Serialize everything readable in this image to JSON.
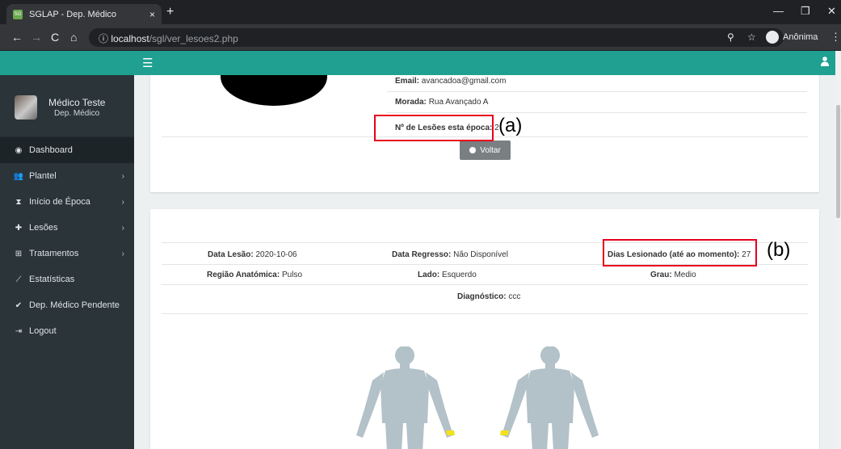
{
  "browser": {
    "tab_title": "SGLAP - Dep. Médico",
    "tab_close": "×",
    "new_tab": "+",
    "url_host": "localhost",
    "url_path": "/sgl/ver_lesoes2.php",
    "incognito_label": "Anônima",
    "minimize": "—",
    "restore": "❐",
    "close": "✕"
  },
  "sidebar": {
    "user_name": "Médico Teste",
    "user_dept": "Dep. Médico",
    "items": [
      {
        "label": "Dashboard",
        "icon": "dashboard-icon",
        "glyph": "◉",
        "chevron": ""
      },
      {
        "label": "Plantel",
        "icon": "users-icon",
        "glyph": "👥",
        "chevron": "›"
      },
      {
        "label": "Início de Época",
        "icon": "hourglass-icon",
        "glyph": "⧗",
        "chevron": "›"
      },
      {
        "label": "Lesões",
        "icon": "ambulance-icon",
        "glyph": "✚",
        "chevron": "›"
      },
      {
        "label": "Tratamentos",
        "icon": "plus-square-icon",
        "glyph": "⊞",
        "chevron": "›"
      },
      {
        "label": "Estatísticas",
        "icon": "chart-icon",
        "glyph": "⟋",
        "chevron": ""
      },
      {
        "label": "Dep. Médico Pendente",
        "icon": "check-icon",
        "glyph": "✔",
        "chevron": ""
      },
      {
        "label": "Logout",
        "icon": "logout-icon",
        "glyph": "⇥",
        "chevron": ""
      }
    ]
  },
  "player": {
    "email_label": "Email:",
    "email_value": "avancadoa@gmail.com",
    "morada_label": "Morada:",
    "morada_value": "Rua Avançado A",
    "lesoes_label": "Nº de Lesões esta época:",
    "lesoes_value": "2",
    "voltar_label": "Voltar"
  },
  "injury": {
    "data_lesao_label": "Data Lesão:",
    "data_lesao_value": "2020-10-06",
    "data_regresso_label": "Data Regresso:",
    "data_regresso_value": "Não Disponível",
    "dias_label": "Dias Lesionado (até ao momento):",
    "dias_value": "27",
    "regiao_label": "Região Anatómica:",
    "regiao_value": "Pulso",
    "lado_label": "Lado:",
    "lado_value": "Esquerdo",
    "grau_label": "Grau:",
    "grau_value": "Medio",
    "diagnostico_label": "Diagnóstico:",
    "diagnostico_value": "ccc"
  },
  "annotations": {
    "a": "(a)",
    "b": "(b)"
  },
  "colors": {
    "topbar": "#1fa091",
    "sidebar": "#2a3439",
    "highlight_box": "#e8001c",
    "body_figure": "#b3c1c8",
    "injury_marker": "#f2e11b"
  }
}
